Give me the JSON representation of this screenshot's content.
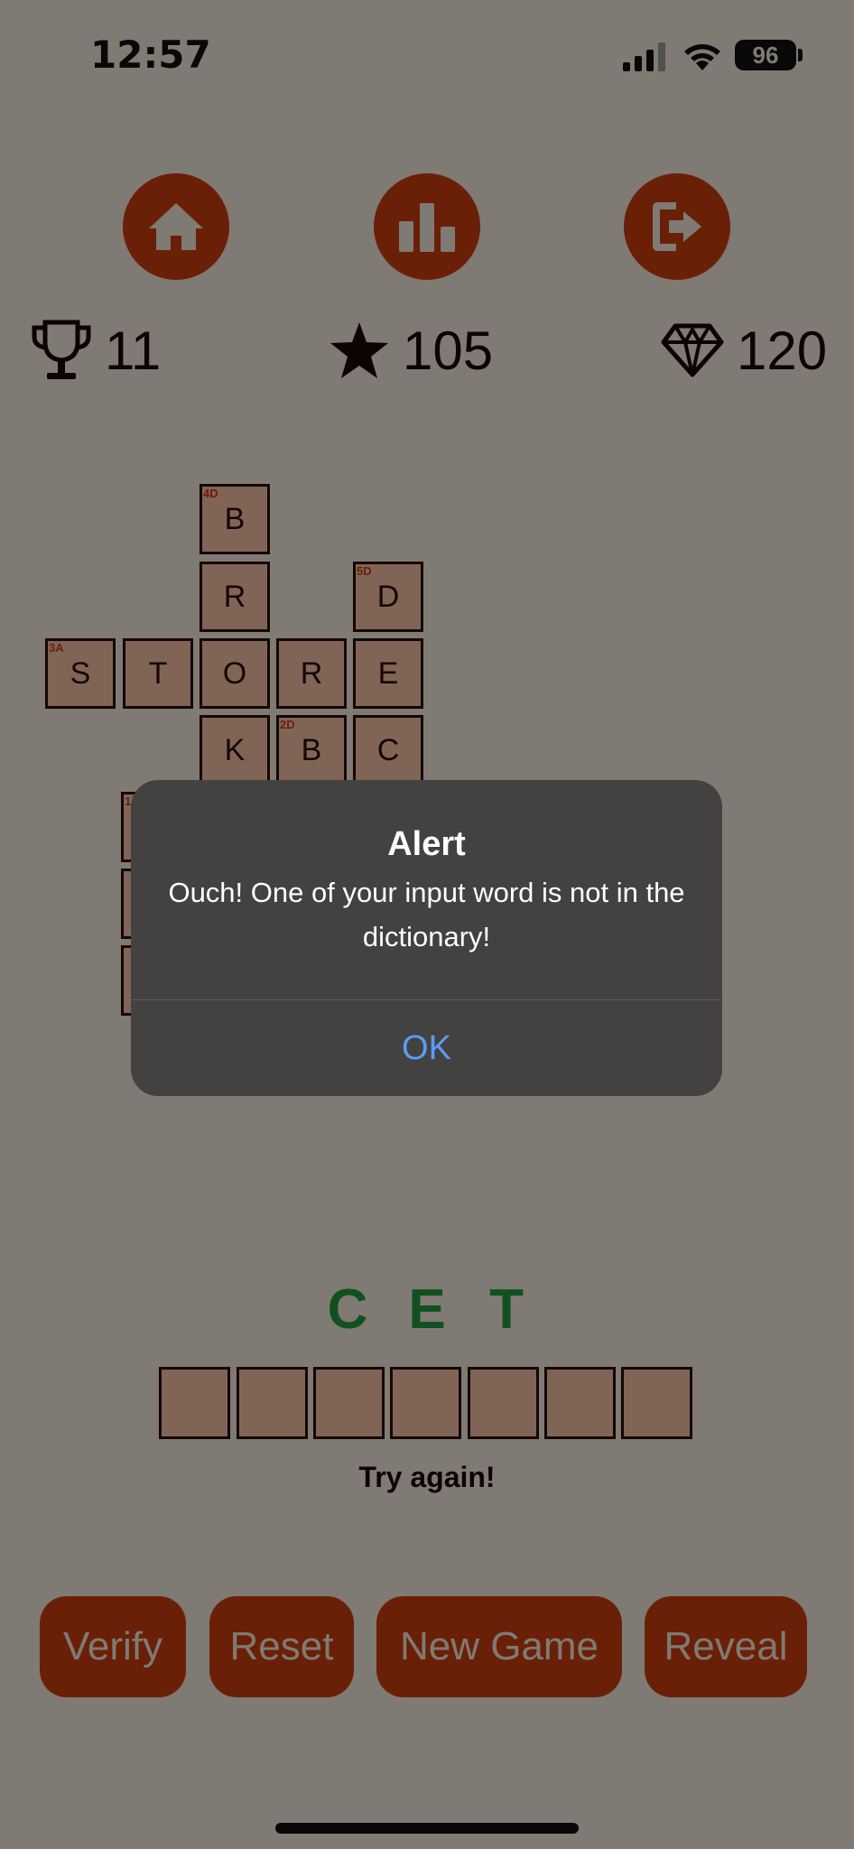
{
  "status_bar": {
    "time": "12:57",
    "battery": "96"
  },
  "nav_buttons": [
    {
      "name": "home",
      "icon": "home-icon"
    },
    {
      "name": "stats",
      "icon": "bar-chart-icon"
    },
    {
      "name": "logout",
      "icon": "exit-icon"
    }
  ],
  "stats": {
    "trophies": "11",
    "stars": "105",
    "gems": "120"
  },
  "board": {
    "tiles": [
      {
        "letter": "B",
        "clue": "4D"
      },
      {
        "letter": "R",
        "clue": ""
      },
      {
        "letter": "D",
        "clue": "5D"
      },
      {
        "letter": "S",
        "clue": "3A"
      },
      {
        "letter": "T",
        "clue": ""
      },
      {
        "letter": "O",
        "clue": ""
      },
      {
        "letter": "R",
        "clue": ""
      },
      {
        "letter": "E",
        "clue": ""
      },
      {
        "letter": "K",
        "clue": ""
      },
      {
        "letter": "B",
        "clue": "2D"
      },
      {
        "letter": "C",
        "clue": ""
      },
      {
        "letter": "",
        "clue": "1"
      },
      {
        "letter": "",
        "clue": ""
      },
      {
        "letter": "",
        "clue": ""
      }
    ]
  },
  "guess": {
    "letters": [
      "C",
      "E",
      "T"
    ],
    "slots": 7,
    "feedback": "Try again!"
  },
  "actions": {
    "verify": "Verify",
    "reset": "Reset",
    "new_game": "New Game",
    "reveal": "Reveal"
  },
  "alert": {
    "title": "Alert",
    "message": "Ouch! One of your input word is not in the dictionary!",
    "ok": "OK"
  },
  "colors": {
    "background": "#f4eadd",
    "accent": "#cc3e0e",
    "tile": "#f6c2a8",
    "guess_letter": "#1f9c3d",
    "alert_button": "#5a9df5"
  }
}
